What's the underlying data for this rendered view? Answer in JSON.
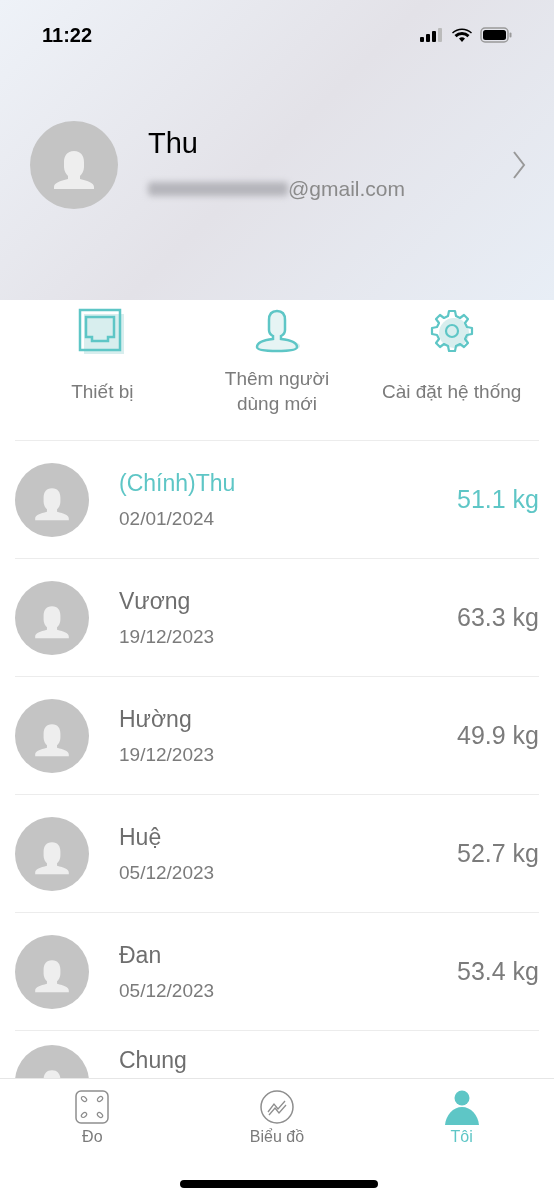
{
  "status_bar": {
    "time": "11:22"
  },
  "profile": {
    "name": "Thu",
    "email": "@gmail.com",
    "email_redacted": true
  },
  "menu": [
    {
      "kind": "device",
      "label": "Thiết bị"
    },
    {
      "kind": "add-user",
      "label": "Thêm người dùng mới"
    },
    {
      "kind": "settings",
      "label": "Cài đặt hệ thống"
    }
  ],
  "members": [
    {
      "name": "(Chính)Thu",
      "date": "02/01/2024",
      "weight": "51.1 kg",
      "primary": true
    },
    {
      "name": "Vương",
      "date": "19/12/2023",
      "weight": "63.3 kg",
      "primary": false
    },
    {
      "name": "Hường",
      "date": "19/12/2023",
      "weight": "49.9 kg",
      "primary": false
    },
    {
      "name": "Huệ",
      "date": "05/12/2023",
      "weight": "52.7 kg",
      "primary": false
    },
    {
      "name": "Đan",
      "date": "05/12/2023",
      "weight": "53.4 kg",
      "primary": false
    },
    {
      "name": "Chung",
      "primary": false
    }
  ],
  "tabs": [
    {
      "kind": "measure",
      "label": "Đo",
      "selected": false
    },
    {
      "kind": "chart",
      "label": "Biểu đồ",
      "selected": false
    },
    {
      "kind": "me",
      "label": "Tôi",
      "selected": true
    }
  ]
}
